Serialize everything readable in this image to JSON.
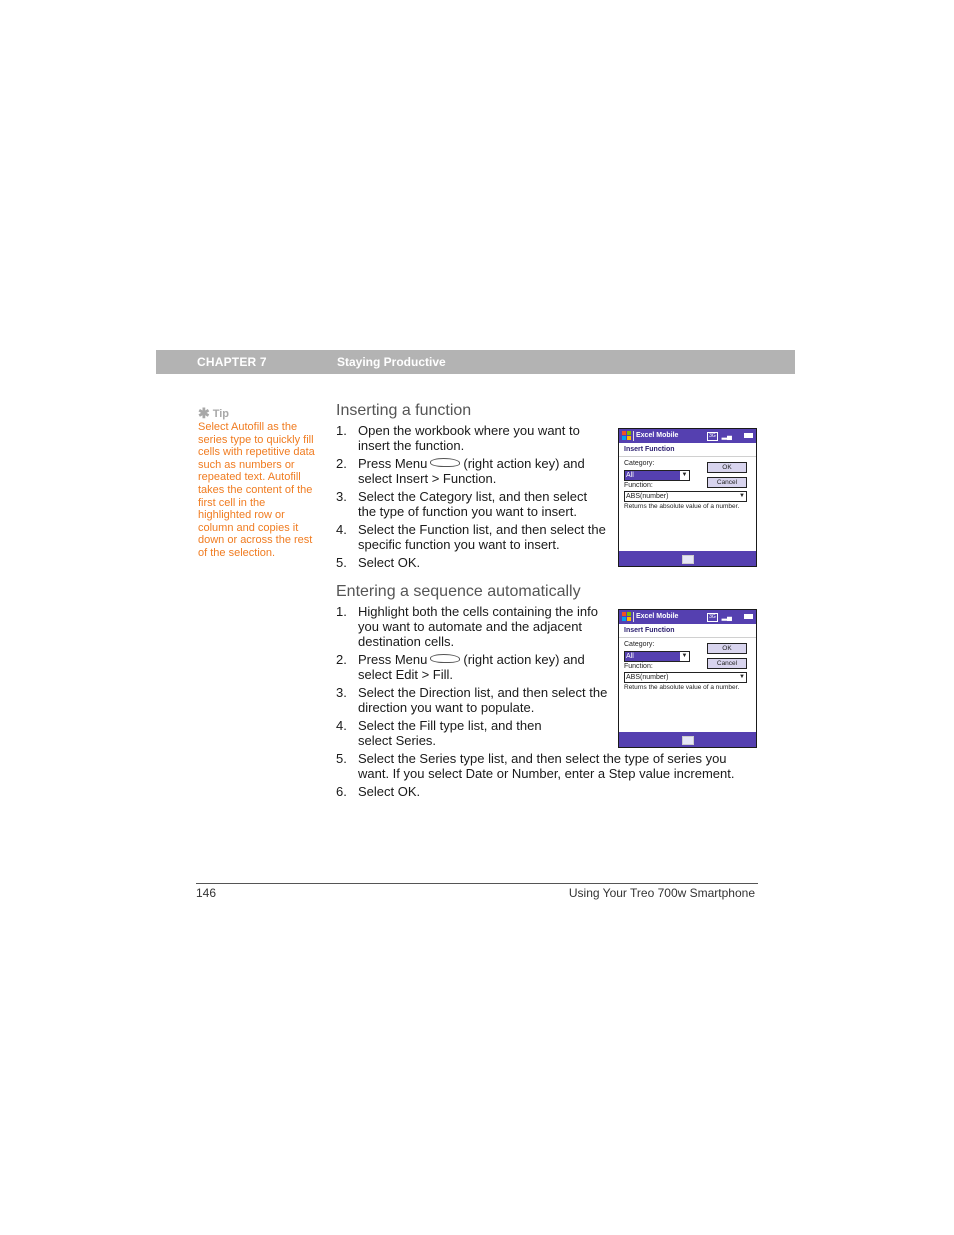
{
  "header": {
    "chapter": "CHAPTER 7",
    "title": "Staying Productive",
    "bar_color": "#b3b3b3"
  },
  "tip": {
    "icon": "asterisk-icon",
    "label": "Tip",
    "text": "Select Autofill as the series type to quickly fill cells with repetitive data such as numbers or repeated text. Autofill takes the content of the first cell in the highlighted row or column and copies it down or across the rest of the selection.",
    "color": "#f07c21"
  },
  "sections": [
    {
      "title": "Inserting a function",
      "steps": [
        {
          "num": "1.",
          "text": "Open the workbook where you want to insert the function."
        },
        {
          "num": "2.",
          "pre": "Press Menu",
          "post": "(right action key) and select Insert > Function."
        },
        {
          "num": "3.",
          "text": "Select the Category list, and then select the type of function you want to insert."
        },
        {
          "num": "4.",
          "text": "Select the Function list, and then select the specific function you want to insert."
        },
        {
          "num": "5.",
          "text": "Select OK."
        }
      ]
    },
    {
      "title": "Entering a sequence automatically",
      "steps": [
        {
          "num": "1.",
          "text": "Highlight both the cells containing the info you want to automate and the adjacent destination cells."
        },
        {
          "num": "2.",
          "pre": "Press Menu",
          "post": "(right action key) and select Edit > Fill."
        },
        {
          "num": "3.",
          "text": "Select the Direction list, and then select the direction you want to populate."
        },
        {
          "num": "4.",
          "text": "Select the Fill type list, and then select Series."
        },
        {
          "num": "5.",
          "text": "Select the Series type list, and then select the type of series you want. If you select Date or Number, enter a Step value increment."
        },
        {
          "num": "6.",
          "text": "Select OK."
        }
      ]
    }
  ],
  "screenshot": {
    "app_name": "Excel Mobile",
    "dialog_title": "Insert Function",
    "category_label": "Category:",
    "category_value": "All",
    "function_label": "Function:",
    "function_value": "ABS(number)",
    "description": "Returns the absolute value of a number.",
    "ok_label": "OK",
    "cancel_label": "Cancel",
    "status_badge": "3G",
    "accent_color": "#5540b0"
  },
  "footer": {
    "page_number": "146",
    "book_title": "Using Your Treo 700w Smartphone"
  }
}
